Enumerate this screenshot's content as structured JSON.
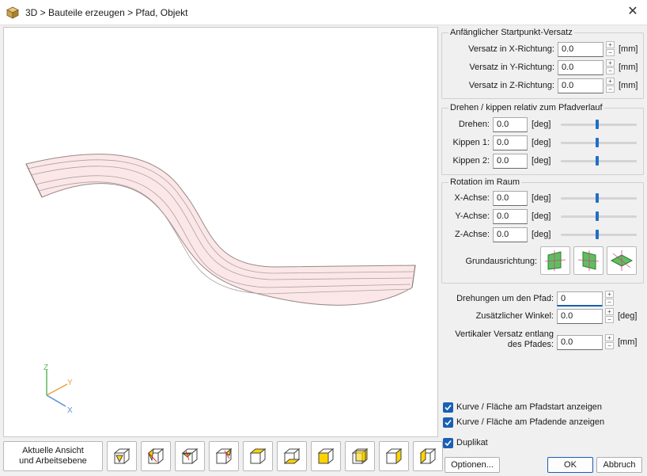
{
  "window": {
    "title": "3D > Bauteile erzeugen > Pfad, Objekt",
    "app_icon": "cube-icon",
    "close_icon": "close-icon"
  },
  "bottom": {
    "view_button_line1": "Aktuelle Ansicht",
    "view_button_line2": "und Arbeitsebene"
  },
  "axes": {
    "z": "Z",
    "y": "Y",
    "x": "X"
  },
  "group1": {
    "title": "Anfänglicher Startpunkt-Versatz",
    "rows": [
      {
        "label": "Versatz in X-Richtung:",
        "value": "0.0",
        "unit": "[mm]"
      },
      {
        "label": "Versatz in Y-Richtung:",
        "value": "0.0",
        "unit": "[mm]"
      },
      {
        "label": "Versatz in Z-Richtung:",
        "value": "0.0",
        "unit": "[mm]"
      }
    ]
  },
  "group2": {
    "title": "Drehen / kippen relativ zum Pfadverlauf",
    "rows": [
      {
        "label": "Drehen:",
        "value": "0.0",
        "unit": "[deg]"
      },
      {
        "label": "Kippen 1:",
        "value": "0.0",
        "unit": "[deg]"
      },
      {
        "label": "Kippen 2:",
        "value": "0.0",
        "unit": "[deg]"
      }
    ]
  },
  "group3": {
    "title": "Rotation im Raum",
    "rows": [
      {
        "label": "X-Achse:",
        "value": "0.0",
        "unit": "[deg]"
      },
      {
        "label": "Y-Achse:",
        "value": "0.0",
        "unit": "[deg]"
      },
      {
        "label": "Z-Achse:",
        "value": "0.0",
        "unit": "[deg]"
      }
    ],
    "orientation_label": "Grundausrichtung:"
  },
  "path": {
    "rotations_label": "Drehungen um den Pfad:",
    "rotations_value": "0",
    "angle_label": "Zusätzlicher Winkel:",
    "angle_value": "0.0",
    "angle_unit": "[deg]",
    "vertical_label_line1": "Vertikaler Versatz entlang",
    "vertical_label_line2": "des Pfades:",
    "vertical_value": "0.0",
    "vertical_unit": "[mm]"
  },
  "options": {
    "show_start": "Kurve / Fläche am Pfadstart anzeigen",
    "show_end": "Kurve / Fläche am Pfadende anzeigen",
    "duplicate": "Duplikat"
  },
  "buttons": {
    "options": "Optionen...",
    "ok": "OK",
    "cancel": "Abbruch"
  },
  "colors": {
    "accent": "#1a5fb4",
    "slider": "#1f6fc5",
    "orient_green": "#5fbf5f"
  }
}
